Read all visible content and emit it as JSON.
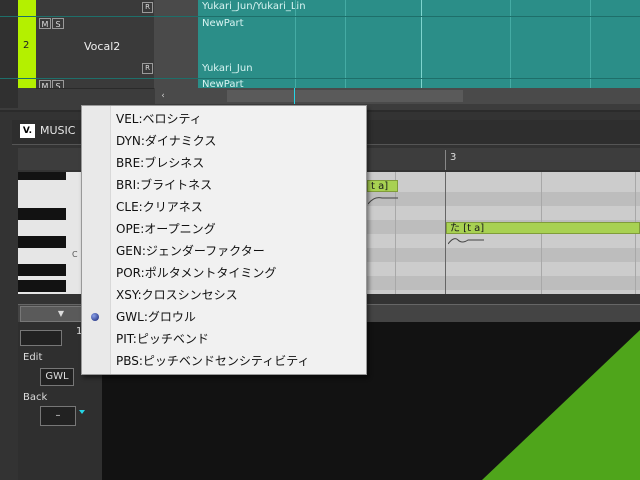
{
  "tracks": [
    {
      "lane_label": "Yukari_Jun/Yukari_Lin"
    },
    {
      "number": "2",
      "name": "Vocal2",
      "part_name": "NewPart",
      "singer": "Yukari_Jun"
    },
    {
      "part_name": "NewPart"
    }
  ],
  "track_buttons": {
    "mute": "M",
    "solo": "S",
    "record": "R"
  },
  "scroll": {
    "left_arrow": "‹"
  },
  "editor": {
    "title": "MUSIC",
    "ruler_marker": "3",
    "piano_c_label": "C",
    "notes": [
      {
        "text": "t a]"
      },
      {
        "text": "た [t a]"
      }
    ],
    "collapse_arrow": "▼",
    "param_index": "1",
    "edit_label": "Edit",
    "edit_value": "GWL",
    "back_label": "Back",
    "back_value": "–"
  },
  "context_menu": {
    "items": [
      {
        "label": "VEL:ベロシティ",
        "selected": false
      },
      {
        "label": "DYN:ダイナミクス",
        "selected": false
      },
      {
        "label": "BRE:ブレシネス",
        "selected": false
      },
      {
        "label": "BRI:ブライトネス",
        "selected": false
      },
      {
        "label": "CLE:クリアネス",
        "selected": false
      },
      {
        "label": "OPE:オープニング",
        "selected": false
      },
      {
        "label": "GEN:ジェンダーファクター",
        "selected": false
      },
      {
        "label": "POR:ポルタメントタイミング",
        "selected": false
      },
      {
        "label": "XSY:クロスシンセシス",
        "selected": false
      },
      {
        "label": "GWL:グロウル",
        "selected": true
      },
      {
        "label": "PIT:ピッチベンド",
        "selected": false
      },
      {
        "label": "PBS:ピッチベンドセンシティビティ",
        "selected": false
      }
    ]
  },
  "colors": {
    "lane": "#2b8e88",
    "track_accent": "#b4f000",
    "note_fill": "#a8d152",
    "param_curve": "#4fa51b"
  }
}
